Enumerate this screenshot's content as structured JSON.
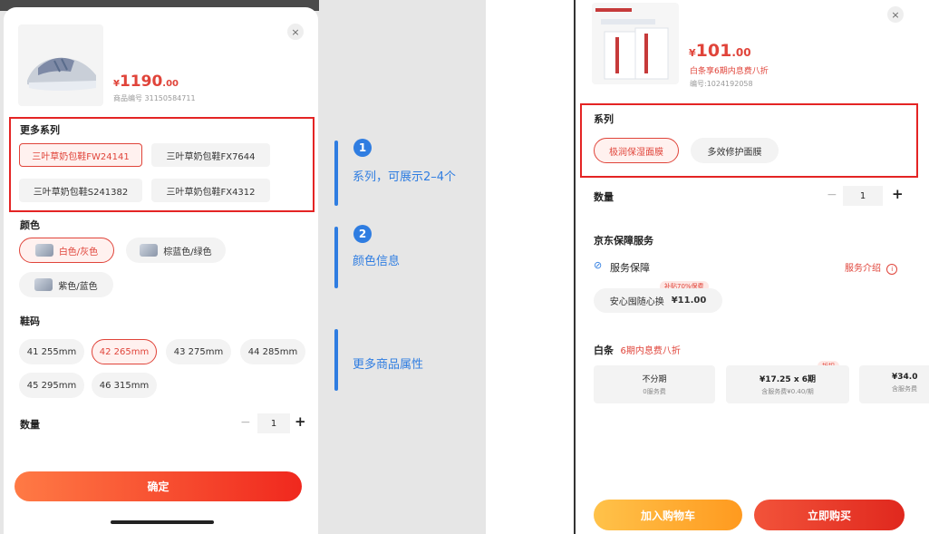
{
  "left": {
    "price_symbol": "¥",
    "price_int": "1190",
    "price_dec": ".00",
    "product_code": "商品编号 31150584711",
    "close": "×",
    "series": {
      "label": "更多系列",
      "items": [
        "三叶草奶包鞋FW24141",
        "三叶草奶包鞋FX7644",
        "三叶草奶包鞋S241382",
        "三叶草奶包鞋FX4312"
      ]
    },
    "color": {
      "label": "颜色",
      "items": [
        "白色/灰色",
        "棕蓝色/绿色",
        "紫色/蓝色"
      ]
    },
    "size": {
      "label": "鞋码",
      "items": [
        "41 255mm",
        "42 265mm",
        "43 275mm",
        "44 285mm",
        "45 295mm",
        "46 315mm"
      ]
    },
    "qty": {
      "label": "数量",
      "minus": "−",
      "value": "1",
      "plus": "+"
    },
    "confirm": "确定"
  },
  "annotations": [
    {
      "num": "1",
      "text": "系列，可展示2–4个"
    },
    {
      "num": "2",
      "text": "颜色信息"
    },
    {
      "num": "",
      "text": "更多商品属性"
    }
  ],
  "right": {
    "close": "×",
    "price_symbol": "¥",
    "price_int": "101",
    "price_dec": ".00",
    "promo": "白条享6期内息费八折",
    "code": "编号:1024192058",
    "series": {
      "label": "系列",
      "items": [
        "极润保湿面膜",
        "多效修护面膜"
      ]
    },
    "qty": {
      "label": "数量",
      "minus": "−",
      "value": "1",
      "plus": "+"
    },
    "service": {
      "title": "京东保障服务",
      "row_label": "服务保障",
      "intro": "服务介绍",
      "tag": "补贴70%保费",
      "item_name": "安心囤随心换",
      "item_price": "¥11.00"
    },
    "baitiao": {
      "label": "白条",
      "promo": "6期内息费八折",
      "tag": "折扣",
      "options": [
        {
          "title": "不分期",
          "sub": "0服务费"
        },
        {
          "title": "¥17.25 x 6期",
          "sub": "含服务费¥0.40/期"
        },
        {
          "title": "¥34.0",
          "sub": "含服务费"
        }
      ]
    },
    "cart_button": "加入购物车",
    "buy_button": "立即购买"
  },
  "colors": {
    "accent": "#e0443a",
    "annotation": "#2f7de1",
    "highlight_box": "#e42424"
  }
}
